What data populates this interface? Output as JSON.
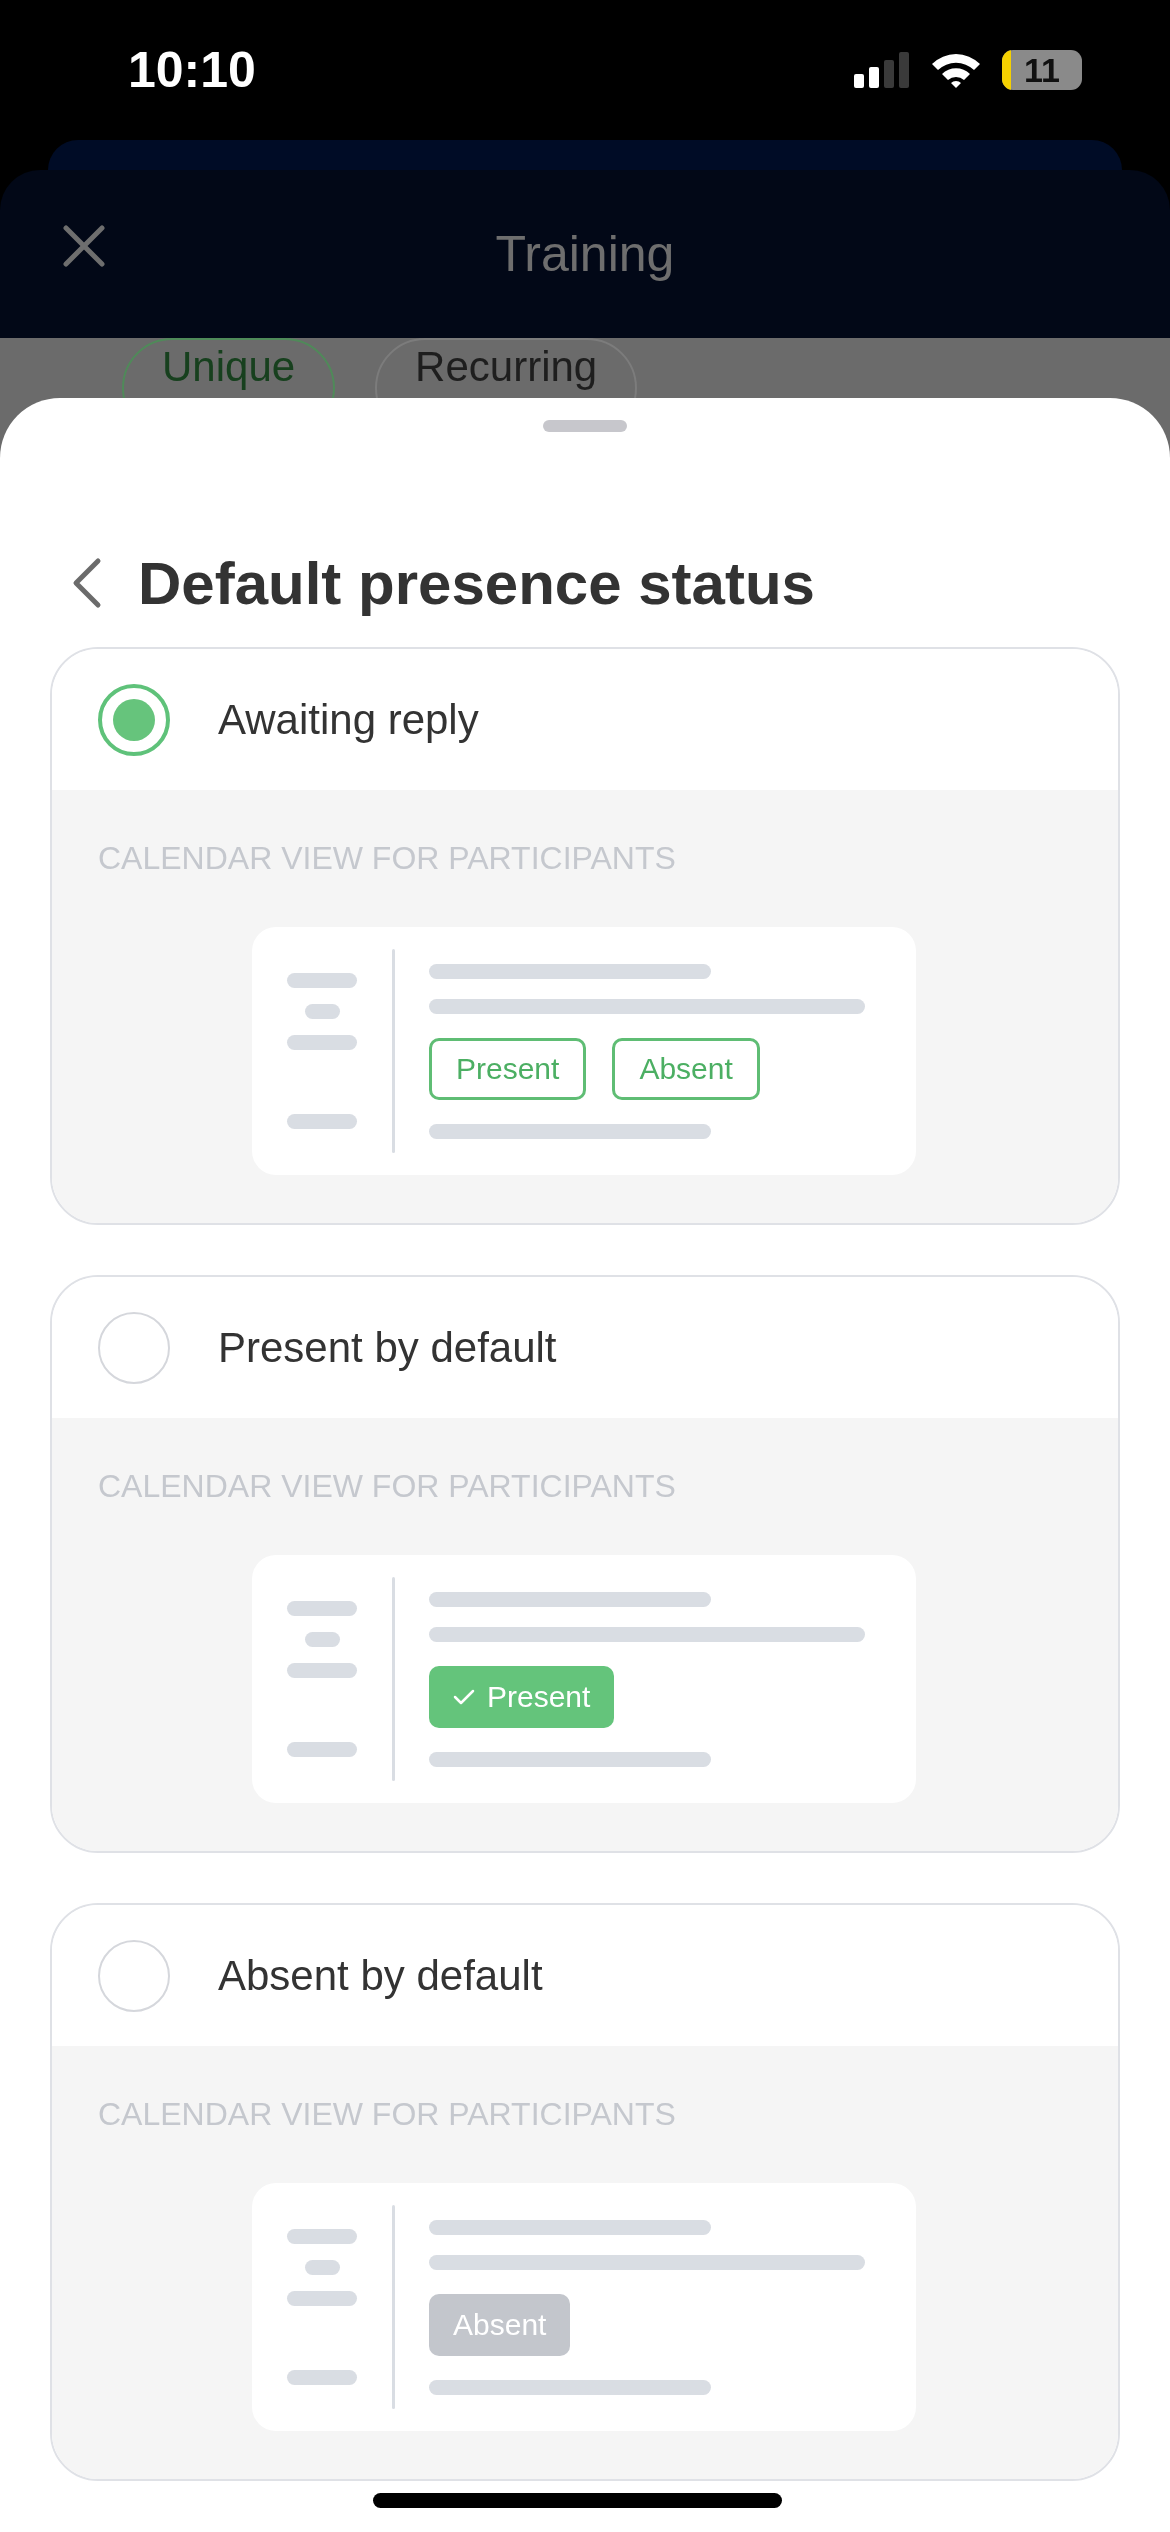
{
  "status_bar": {
    "time": "10:10",
    "battery": "11"
  },
  "header": {
    "title": "Training"
  },
  "segments": [
    {
      "label": "Unique",
      "selected": true
    },
    {
      "label": "Recurring",
      "selected": false
    }
  ],
  "sheet": {
    "title": "Default presence status",
    "options": [
      {
        "label": "Awaiting reply",
        "selected": true,
        "section_label": "CALENDAR VIEW FOR PARTICIPANTS",
        "chips": [
          {
            "label": "Present",
            "kind": "outline"
          },
          {
            "label": "Absent",
            "kind": "outline"
          }
        ]
      },
      {
        "label": "Present by default",
        "selected": false,
        "section_label": "CALENDAR VIEW FOR PARTICIPANTS",
        "chips": [
          {
            "label": "Present",
            "kind": "filled"
          }
        ]
      },
      {
        "label": "Absent by default",
        "selected": false,
        "section_label": "CALENDAR VIEW FOR PARTICIPANTS",
        "chips": [
          {
            "label": "Absent",
            "kind": "muted"
          }
        ]
      }
    ]
  }
}
